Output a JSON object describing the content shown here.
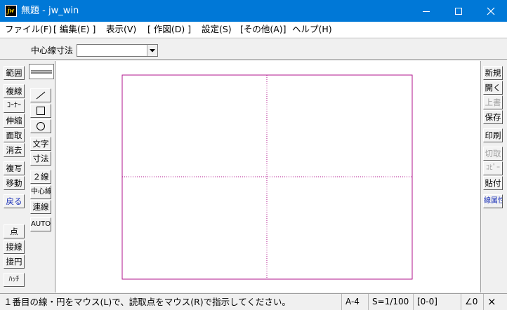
{
  "window": {
    "title": "無題 - jw_win",
    "app_icon_label": "jw",
    "controls": [
      "minimize-icon",
      "maximize-icon",
      "close-icon"
    ]
  },
  "menu": [
    "ファイル(F)",
    "[ 編集(E) ]",
    "表示(V)",
    "[ 作図(D) ]",
    "設定(S)",
    "[その他(A)]",
    "ヘルプ(H)"
  ],
  "toolbar": {
    "label": "中心線寸法",
    "combo_value": ""
  },
  "left_tools_1": {
    "group1": [
      "範囲",
      "複線",
      "ｺｰﾅｰ",
      "伸縮",
      "面取",
      "消去"
    ],
    "group2": [
      "複写",
      "移動",
      "戻る"
    ],
    "group3": [
      "点",
      "接線",
      "接円",
      "ﾊｯﾁ"
    ]
  },
  "left_tools_2": {
    "shapes": [
      "line-icon",
      "rectangle-icon",
      "circle-icon"
    ],
    "text_tools": [
      "文字",
      "寸法"
    ],
    "line_tools": [
      "２線",
      "中心線",
      "連線"
    ],
    "auto": "AUTO"
  },
  "right_tools": {
    "file": [
      "新規",
      "開く",
      "上書",
      "保存"
    ],
    "edit": [
      "印刷",
      "切取",
      "ｺﾋﾟｰ",
      "貼付"
    ],
    "attr": "線属性"
  },
  "status": {
    "message": "１番目の線・円をマウス(L)で、読取点をマウス(R)で指示してください。",
    "paper": "A-4",
    "scale": "S=1/100",
    "layer": "[0-0]",
    "angle": "∠0",
    "close": "×"
  },
  "colors": {
    "title_bar": "#0078d7",
    "frame": "#b0168e",
    "disabled": "#a0a0a0",
    "accent_text": "#1a30b8"
  }
}
